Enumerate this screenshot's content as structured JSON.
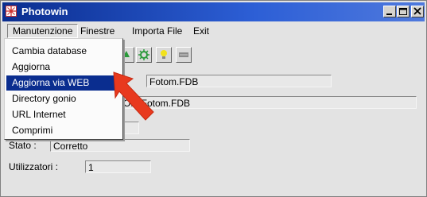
{
  "window": {
    "title": "Photowin"
  },
  "menubar": [
    {
      "id": "manutenzione",
      "label": "Manutenzione"
    },
    {
      "id": "finestre",
      "label": "Finestre"
    },
    {
      "id": "importa",
      "label": "Importa File"
    },
    {
      "id": "exit",
      "label": "Exit"
    }
  ],
  "dropdown": {
    "items": [
      "Cambia database",
      "Aggiorna",
      "Aggiorna via WEB",
      "Directory gonio",
      "URL Internet",
      "Comprimi"
    ],
    "selected": "Aggiorna via WEB"
  },
  "fields": {
    "db_name": "Fotom.FDB",
    "db_path": "OM\\Fotom.FDB",
    "stato_label": "Stato :",
    "stato_value": "Corretto",
    "utilizzatori_label": "Utilizzatori :",
    "utilizzatori_value": "1"
  },
  "colors": {
    "title_bar": "#0a2d8f",
    "selection": "#0a2d8f",
    "arrow": "#e8391e"
  }
}
